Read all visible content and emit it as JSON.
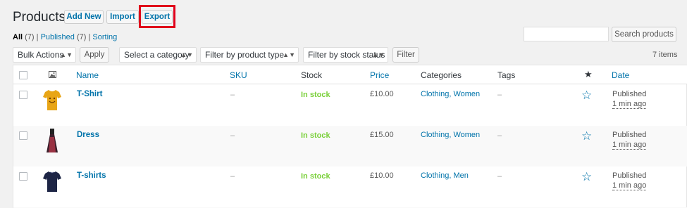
{
  "header": {
    "title": "Products",
    "add_new": "Add New",
    "import": "Import",
    "export": "Export"
  },
  "subsub": {
    "all_label": "All",
    "all_count": "(7)",
    "sep1": "|",
    "published_label": "Published",
    "published_count": "(7)",
    "sep2": "|",
    "sorting": "Sorting"
  },
  "search": {
    "button": "Search products",
    "value": ""
  },
  "filters": {
    "bulk_actions": "Bulk Actions",
    "apply": "Apply",
    "category": "Select a category",
    "product_type": "Filter by product type",
    "stock_status": "Filter by stock status",
    "filter": "Filter",
    "items_count": "7 items"
  },
  "columns": {
    "name": "Name",
    "sku": "SKU",
    "stock": "Stock",
    "price": "Price",
    "categories": "Categories",
    "tags": "Tags",
    "date": "Date"
  },
  "rows": [
    {
      "name": "T-Shirt",
      "sku": "–",
      "stock": "In stock",
      "price": "£10.00",
      "categories": "Clothing, Women",
      "tags": "–",
      "status": "Published",
      "ago": "1 min ago",
      "thumb": "yellow-tshirt-icon"
    },
    {
      "name": "Dress",
      "sku": "–",
      "stock": "In stock",
      "price": "£15.00",
      "categories": "Clothing, Women",
      "tags": "–",
      "status": "Published",
      "ago": "1 min ago",
      "thumb": "dress-icon"
    },
    {
      "name": "T-shirts",
      "sku": "–",
      "stock": "In stock",
      "price": "£10.00",
      "categories": "Clothing, Men",
      "tags": "–",
      "status": "Published",
      "ago": "1 min ago",
      "thumb": "navy-tshirt-icon"
    }
  ],
  "colors": {
    "link": "#0073aa",
    "in_stock": "#7ad03a",
    "highlight": "#e0001b"
  }
}
